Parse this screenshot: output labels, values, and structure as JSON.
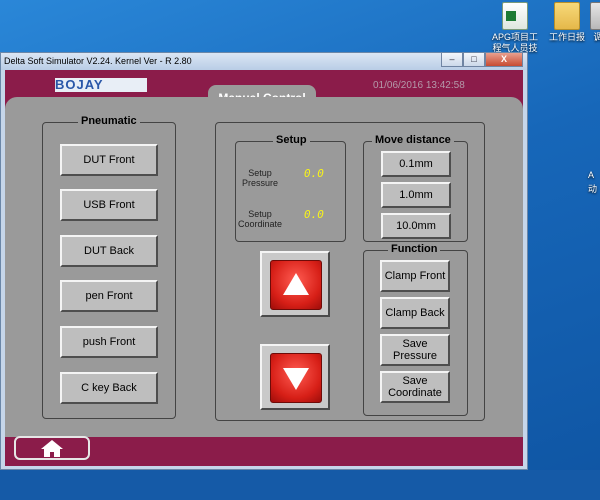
{
  "desktop": {
    "icons": [
      {
        "label": "APG项目工程气人员技能...",
        "icon": "excel-file-icon"
      },
      {
        "label": "工作日报",
        "icon": "folder-icon"
      },
      {
        "label": "调",
        "icon": "document-icon"
      }
    ],
    "side_text": [
      "A",
      "动"
    ]
  },
  "window": {
    "title": "Delta Soft Simulator V2.24. Kernel Ver - R 2.80",
    "buttons": {
      "minimize": "–",
      "maximize": "□",
      "close": "X"
    }
  },
  "header": {
    "logo_text": "BOJAY",
    "datetime": "01/06/2016    13:42:58"
  },
  "panel": {
    "title": "Manual Control"
  },
  "pneumatic": {
    "label": "Pneumatic",
    "buttons": [
      "DUT Front",
      "USB Front",
      "DUT Back",
      "pen Front",
      "push Front",
      "C key Back"
    ]
  },
  "setup": {
    "label": "Setup",
    "pressure_label": "Setup Pressure",
    "pressure_value": "0.0",
    "coordinate_label": "Setup Coordinate",
    "coordinate_value": "0.0"
  },
  "move_distance": {
    "label": "Move distance",
    "options": [
      "0.1mm",
      "1.0mm",
      "10.0mm"
    ]
  },
  "function": {
    "label": "Function",
    "buttons": [
      "Clamp Front",
      "Clamp Back",
      "Save Pressure",
      "Save Coordinate"
    ]
  },
  "colors": {
    "frame": "#8b1c4a",
    "panel": "#9a9a9a",
    "button": "#bebebe",
    "arrow": "#d71f17",
    "value": "#f7f21b"
  }
}
